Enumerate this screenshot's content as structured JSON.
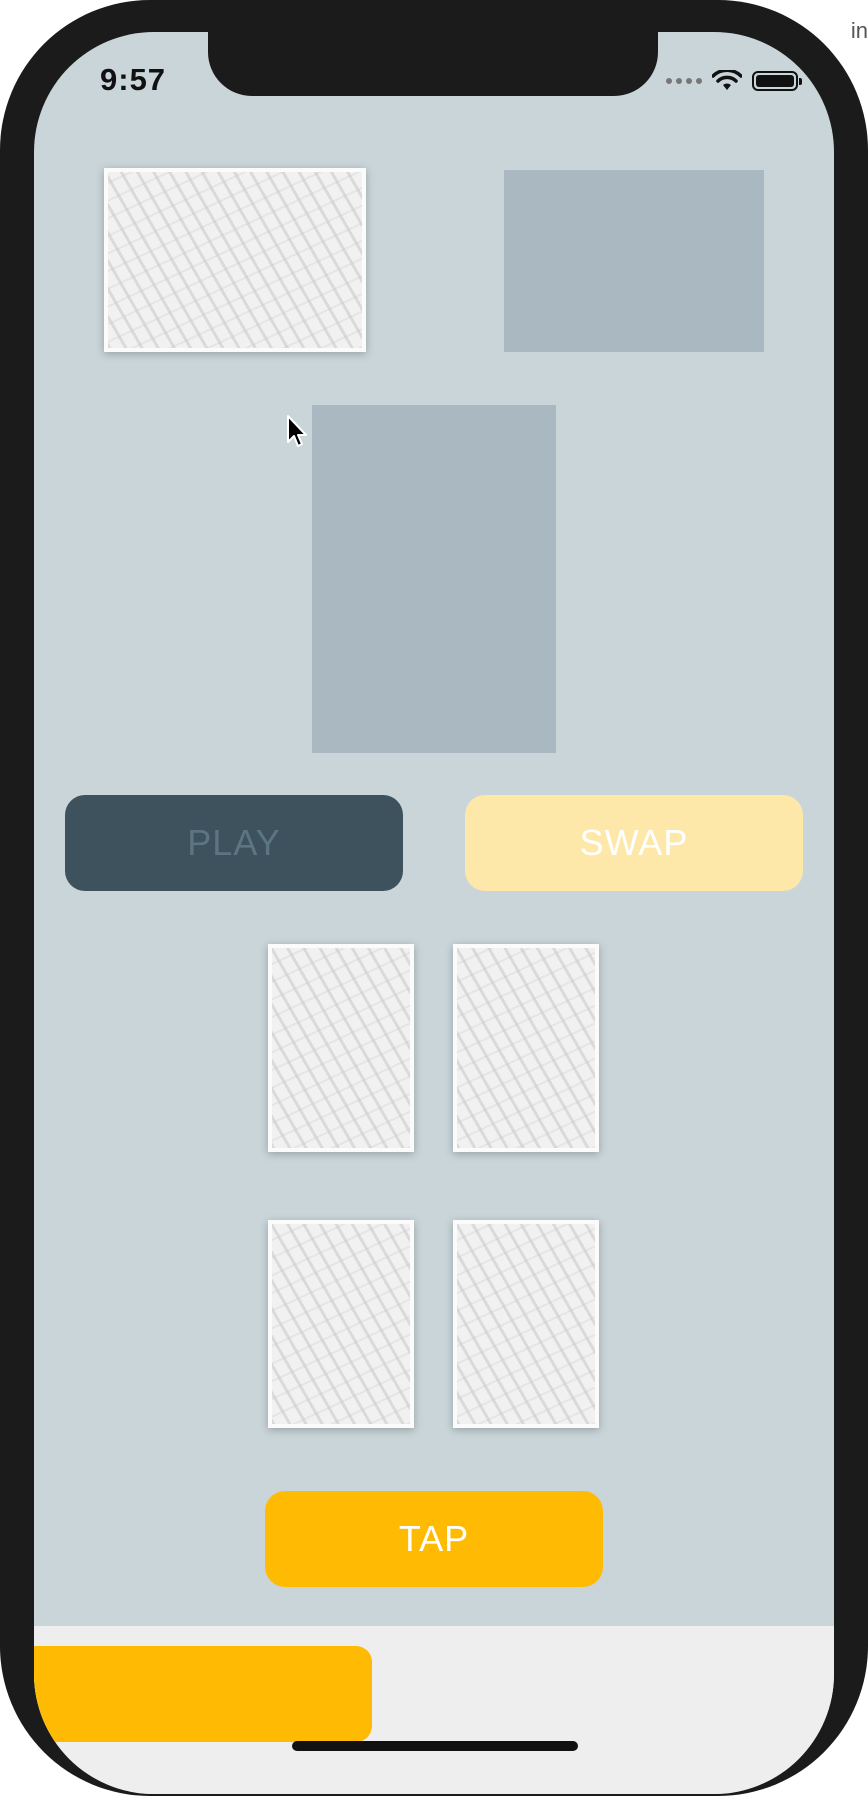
{
  "status_bar": {
    "time": "9:57",
    "signal_icon": "signal-dots-icon",
    "wifi_icon": "wifi-icon",
    "battery_icon": "battery-icon"
  },
  "corner_label": "in",
  "game": {
    "deck_card": "card-back-pattern",
    "discard_slot": "empty-card-slot",
    "center_slot": "empty-card-slot",
    "hand_cards_count": 4
  },
  "buttons": {
    "play_label": "PLAY",
    "swap_label": "SWAP",
    "tap_label": "TAP"
  },
  "colors": {
    "background": "#c9d5d9",
    "slot": "#a9b8c1",
    "play_button": "#3e525d",
    "swap_button": "#fde8a9",
    "tap_button": "#ffbb04"
  }
}
